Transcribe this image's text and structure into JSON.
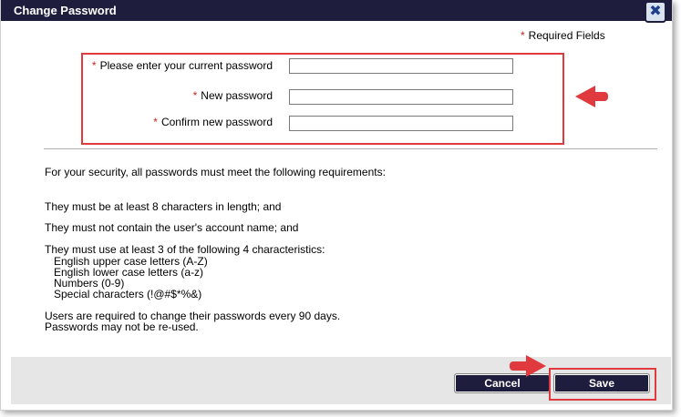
{
  "dialog": {
    "title": "Change Password",
    "close_symbol": "✖"
  },
  "required_note": {
    "star": "*",
    "text": "Required Fields"
  },
  "fields": [
    {
      "star": "*",
      "label": "Please enter your current password",
      "value": ""
    },
    {
      "star": "*",
      "label": "New password",
      "value": ""
    },
    {
      "star": "*",
      "label": "Confirm new password",
      "value": ""
    }
  ],
  "requirements": {
    "intro": "For your security, all passwords must meet the following requirements:",
    "rule_length": "They must be at least 8 characters in length; and",
    "rule_account": "They must not contain the user's account name; and",
    "rule_characteristics": "They must use at least 3 of the following 4 characteristics:",
    "characteristics": [
      "English upper case letters (A-Z)",
      "English lower case letters (a-z)",
      "Numbers (0-9)",
      "Special characters (!@#$*%&)"
    ],
    "change_note": "Users are required to change their passwords every 90 days.",
    "reuse_note": "Passwords may not be re-used."
  },
  "buttons": {
    "cancel": "Cancel",
    "save": "Save"
  },
  "colors": {
    "titlebar": "#1f1d3e",
    "highlight": "#e0393e",
    "required_star": "#d42020"
  }
}
